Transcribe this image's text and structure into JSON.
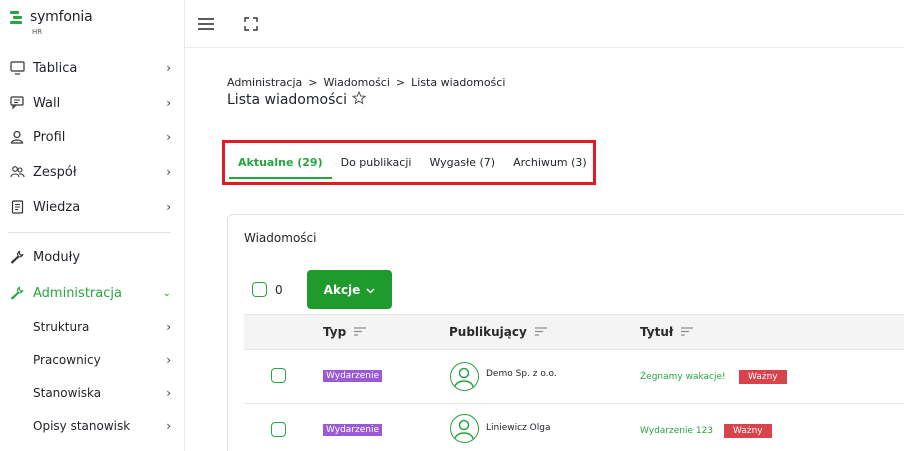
{
  "brand": {
    "name": "symfonia",
    "sub": "HR",
    "color": "#26a640"
  },
  "sidebar": {
    "items": [
      {
        "label": "Tablica",
        "icon": "monitor-icon"
      },
      {
        "label": "Wall",
        "icon": "chat-icon"
      },
      {
        "label": "Profil",
        "icon": "user-icon"
      },
      {
        "label": "Zespół",
        "icon": "team-icon"
      },
      {
        "label": "Wiedza",
        "icon": "book-icon"
      },
      {
        "label": "Moduły",
        "icon": "wrench-icon"
      },
      {
        "label": "Administracja",
        "icon": "wrench-icon",
        "active": true
      }
    ],
    "subitems": [
      {
        "label": "Struktura"
      },
      {
        "label": "Pracownicy"
      },
      {
        "label": "Stanowiska"
      },
      {
        "label": "Opisy stanowisk"
      }
    ]
  },
  "topbar": {
    "menu_icon": "hamburger-icon",
    "fullscreen_icon": "fullscreen-icon"
  },
  "breadcrumb": [
    "Administracja",
    ">",
    "Wiadomości",
    ">",
    "Lista wiadomości"
  ],
  "page_title": "Lista wiadomości",
  "tabs": [
    {
      "label": "Aktualne (29)",
      "active": true
    },
    {
      "label": "Do publikacji"
    },
    {
      "label": "Wygasłe (7)"
    },
    {
      "label": "Archiwum (3)"
    }
  ],
  "card": {
    "title": "Wiadomości",
    "selected_count": "0",
    "actions_label": "Akcje",
    "columns": [
      "Typ",
      "Publikujący",
      "Tytuł"
    ],
    "rows": [
      {
        "type": "Wydarzenie",
        "publisher": "Demo Sp. z o.o.",
        "title": "Żegnamy wakacje!",
        "importance": "Ważny"
      },
      {
        "type": "Wydarzenie",
        "publisher": "Liniewicz Olga",
        "title": "Wydarzenie 123",
        "importance": "Ważny"
      }
    ]
  },
  "colors": {
    "accent": "#26a640",
    "button": "#1f9b2d",
    "highlight": "#e11b22",
    "type_badge": "#9b59d6",
    "importance_badge": "#d9434b"
  }
}
